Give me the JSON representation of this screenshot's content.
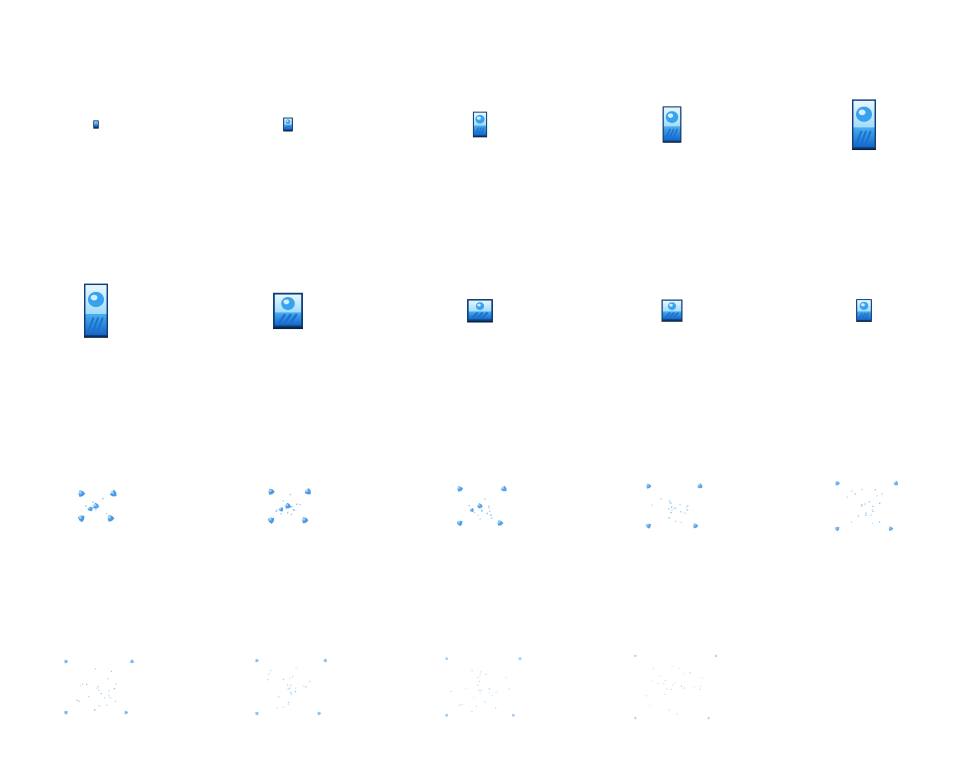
{
  "sprite_sheet": {
    "name": "ice-card-shatter-effect",
    "columns": 5,
    "rows": 4,
    "frames": [
      {
        "kind": "card",
        "scale": 0.18,
        "aspect": 1.35
      },
      {
        "kind": "card",
        "scale": 0.32,
        "aspect": 1.35
      },
      {
        "kind": "card",
        "scale": 0.47,
        "aspect": 1.75
      },
      {
        "kind": "card",
        "scale": 0.62,
        "aspect": 1.9
      },
      {
        "kind": "card",
        "scale": 0.8,
        "aspect": 2.05
      },
      {
        "kind": "card",
        "scale": 0.8,
        "aspect": 2.2
      },
      {
        "kind": "card",
        "scale": 1.0,
        "aspect": 1.15
      },
      {
        "kind": "card",
        "scale": 0.86,
        "aspect": 0.85
      },
      {
        "kind": "card",
        "scale": 0.7,
        "aspect": 1.0
      },
      {
        "kind": "card",
        "scale": 0.52,
        "aspect": 1.4
      },
      {
        "kind": "burst",
        "spread": 0.3,
        "opacity": 1.0
      },
      {
        "kind": "burst",
        "spread": 0.4,
        "opacity": 1.0
      },
      {
        "kind": "burst",
        "spread": 0.55,
        "opacity": 0.95
      },
      {
        "kind": "burst",
        "spread": 0.7,
        "opacity": 0.9
      },
      {
        "kind": "burst",
        "spread": 0.85,
        "opacity": 0.85
      },
      {
        "kind": "burst",
        "spread": 1.0,
        "opacity": 0.75
      },
      {
        "kind": "burst",
        "spread": 1.05,
        "opacity": 0.65
      },
      {
        "kind": "burst",
        "spread": 1.15,
        "opacity": 0.5
      },
      {
        "kind": "burst",
        "spread": 1.3,
        "opacity": 0.4
      },
      {
        "kind": "empty"
      }
    ]
  },
  "colors": {
    "frame_border": "#0e3f7a",
    "frame_shadow": "#0a2240",
    "sky_top": "#e8f7ff",
    "sky_mid": "#9fdcfb",
    "water_top": "#48aef0",
    "water_bottom": "#1666c8",
    "orb_light": "#cfeeff",
    "orb": "#38a2ee",
    "orb_dark": "#1a6fd0",
    "shard": "#4a9ae8",
    "shard_light": "#9fd2fb",
    "sparkle": "#66b4f2"
  }
}
